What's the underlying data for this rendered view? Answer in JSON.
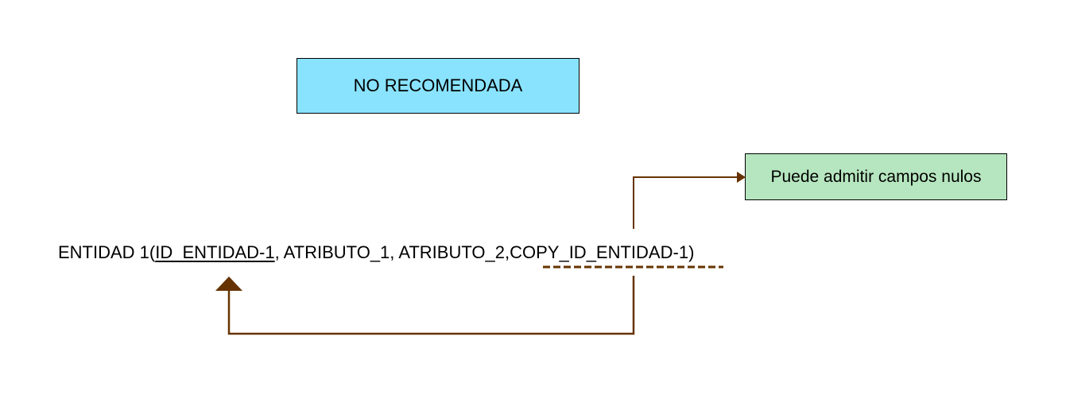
{
  "diagram": {
    "title": "NO RECOMENDADA",
    "note": "Puede admitir campos nulos",
    "relation": {
      "entity_prefix": "ENTIDAD 1(",
      "primary_key": "ID_ENTIDAD-1",
      "sep_1": ", ",
      "attribute_1": "ATRIBUTO_1",
      "sep_2": ", ",
      "attribute_2": "ATRIBUTO_2",
      "sep_3": ",",
      "foreign_key": "COPY_ID_ENTIDAD-1",
      "close": ")"
    },
    "colors": {
      "title_fill": "#89e3ff",
      "note_fill": "#b6e6bf",
      "connector": "#663300"
    }
  }
}
